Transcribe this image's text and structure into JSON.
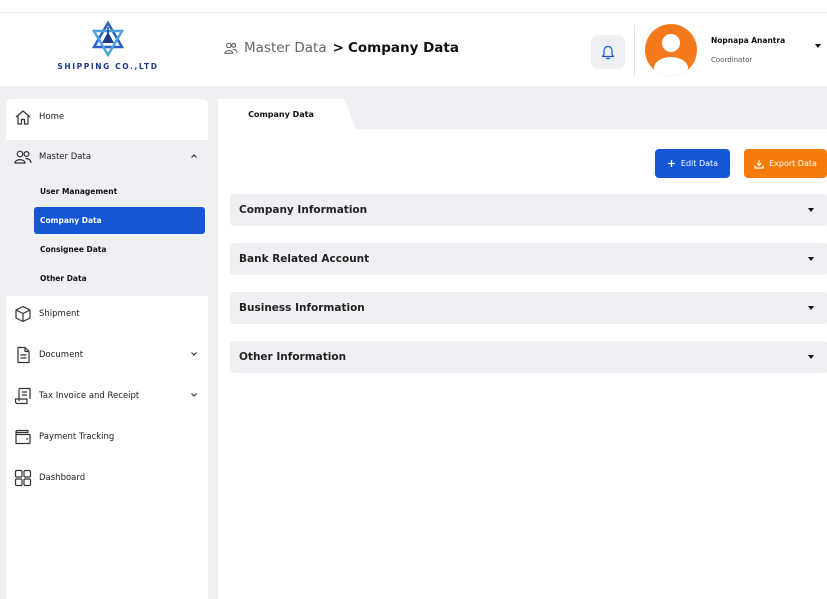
{
  "brand": {
    "name": "SHIPPING CO.,LTD",
    "logo_icon": "star-of-david-ship-logo",
    "color": "#1b3b86"
  },
  "breadcrumb": {
    "icon": "users-icon",
    "root": "Master Data",
    "separator": ">",
    "current": "Company Data"
  },
  "notifications": {
    "icon": "bell-icon"
  },
  "user": {
    "name": "Nopnapa Anantra",
    "role": "Coordinator",
    "avatar_color": "#f47a1d"
  },
  "sidebar": {
    "items": [
      {
        "label": "Home",
        "icon": "home-icon"
      },
      {
        "label": "Master Data",
        "icon": "users-icon",
        "expanded": true
      },
      {
        "label": "Shipment",
        "icon": "box-icon"
      },
      {
        "label": "Document",
        "icon": "file-icon"
      },
      {
        "label": "Tax Invoice and Receipt",
        "icon": "receipt-icon"
      },
      {
        "label": "Payment Tracking",
        "icon": "wallet-icon"
      },
      {
        "label": "Dashboard",
        "icon": "grid-icon"
      }
    ],
    "master_sub": [
      {
        "label": "User Management"
      },
      {
        "label": "Company Data",
        "active": true
      },
      {
        "label": "Consignee Data"
      },
      {
        "label": "Other Data"
      }
    ]
  },
  "tab": {
    "label": "Company Data"
  },
  "actions": {
    "edit_label": "Edit Data",
    "export_label": "Export Data",
    "edit_color": "#1556d6",
    "export_color": "#f57c0a"
  },
  "sections": [
    {
      "label": "Company Information"
    },
    {
      "label": "Bank Related Account"
    },
    {
      "label": "Business Information"
    },
    {
      "label": "Other Information"
    }
  ]
}
